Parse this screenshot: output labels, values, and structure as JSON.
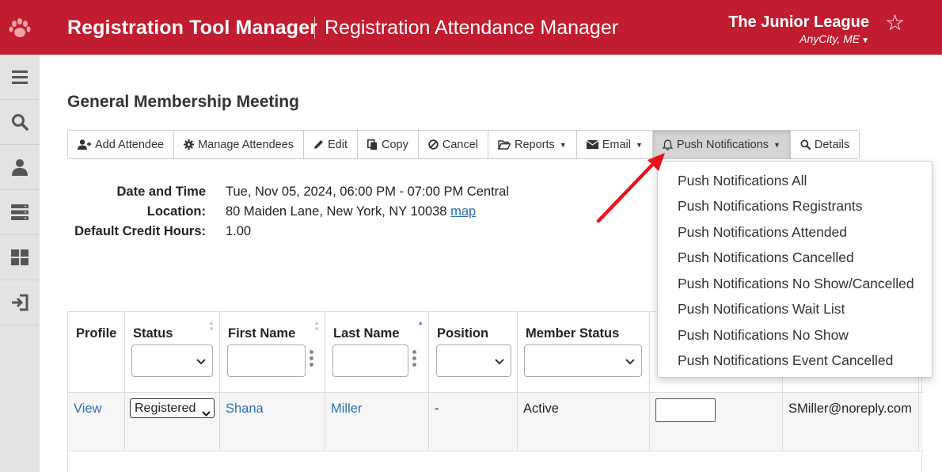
{
  "header": {
    "app_title": "Registration Tool Manager",
    "app_subtitle": "Registration Attendance Manager",
    "org_name": "The Junior League",
    "org_city": "AnyCity, ME",
    "brand_color": "#c21c31"
  },
  "sidebar": {
    "items": [
      {
        "icon": "menu-icon"
      },
      {
        "icon": "search-icon"
      },
      {
        "icon": "user-icon"
      },
      {
        "icon": "server-icon"
      },
      {
        "icon": "dashboard-icon"
      },
      {
        "icon": "logout-icon"
      }
    ]
  },
  "page": {
    "title": "General Membership Meeting"
  },
  "toolbar": {
    "add_attendee": "Add Attendee",
    "manage_attendees": "Manage Attendees",
    "edit": "Edit",
    "copy": "Copy",
    "cancel": "Cancel",
    "reports": "Reports",
    "email": "Email",
    "push_notifications": "Push Notifications",
    "details": "Details"
  },
  "details": {
    "date_label": "Date and Time",
    "date_value": "Tue, Nov 05, 2024, 06:00 PM - 07:00 PM Central",
    "location_label": "Location:",
    "location_value": "80 Maiden Lane, New York, NY 10038",
    "map_link": "map",
    "credit_label": "Default Credit Hours:",
    "credit_value": "1.00"
  },
  "table": {
    "headers": {
      "profile": "Profile",
      "status": "Status",
      "first_name": "First Name",
      "last_name": "Last Name",
      "position": "Position",
      "member_status": "Member Status"
    },
    "row": {
      "profile": "View",
      "status": "Registered",
      "first_name": "Shana",
      "last_name": "Miller",
      "position": "-",
      "member_status": "Active",
      "email": "SMiller@noreply.com"
    }
  },
  "push_menu": {
    "items": [
      "Push Notifications All",
      "Push Notifications Registrants",
      "Push Notifications Attended",
      "Push Notifications Cancelled",
      "Push Notifications No Show/Cancelled",
      "Push Notifications Wait List",
      "Push Notifications No Show",
      "Push Notifications Event Cancelled"
    ]
  }
}
